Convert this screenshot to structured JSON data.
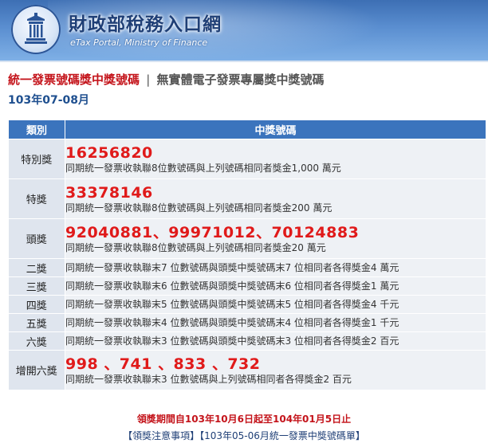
{
  "header": {
    "title": "財政部稅務入口網",
    "subtitle": "eTax Portal, Ministry of Finance",
    "logo_icon": "ministry-emblem-icon"
  },
  "section": {
    "heading_main": "統一發票號碼獎中獎號碼",
    "heading_sep": "|",
    "heading_alt": "無實體電子發票專屬獎中獎號碼",
    "period": "103年07-08月"
  },
  "table": {
    "col_category": "類別",
    "col_numbers": "中獎號碼",
    "rows": [
      {
        "category": "特別獎",
        "number": "16256820",
        "desc": "同期統一發票收執聯8位數號碼與上列號碼相同者獎金1,000 萬元"
      },
      {
        "category": "特獎",
        "number": "33378146",
        "desc": "同期統一發票收執聯8位數號碼與上列號碼相同者獎金200 萬元"
      },
      {
        "category": "頭獎",
        "number": "92040881、99971012、70124883",
        "desc": "同期統一發票收執聯8位數號碼與上列號碼相同者獎金20 萬元"
      },
      {
        "category": "二獎",
        "desc": "同期統一發票收執聯末7 位數號碼與頭獎中獎號碼末7 位相同者各得獎金4 萬元"
      },
      {
        "category": "三獎",
        "desc": "同期統一發票收執聯末6 位數號碼與頭獎中獎號碼末6 位相同者各得獎金1 萬元"
      },
      {
        "category": "四獎",
        "desc": "同期統一發票收執聯末5 位數號碼與頭獎中獎號碼末5 位相同者各得獎金4 千元"
      },
      {
        "category": "五獎",
        "desc": "同期統一發票收執聯末4 位數號碼與頭獎中獎號碼末4 位相同者各得獎金1 千元"
      },
      {
        "category": "六獎",
        "desc": "同期統一發票收執聯末3 位數號碼與頭獎中獎號碼末3 位相同者各得獎金2 百元"
      },
      {
        "category": "增開六獎",
        "number": "998 、741 、833 、732",
        "desc": "同期統一發票收執聯末3 位數號碼與上列號碼相同者各得獎金2 百元"
      }
    ]
  },
  "footer": {
    "deadline": "領獎期間自103年10月6日起至104年01月5日止",
    "bracket_open": "【",
    "bracket_close": "】",
    "link_notes": "領獎注意事項",
    "link_prev": "103年05-06月統一發票中獎號碼單"
  },
  "colors": {
    "header_blue": "#3d6fb4",
    "table_header": "#3b74bd",
    "prize_red": "#e01a1a",
    "heading_red": "#c4141b"
  }
}
